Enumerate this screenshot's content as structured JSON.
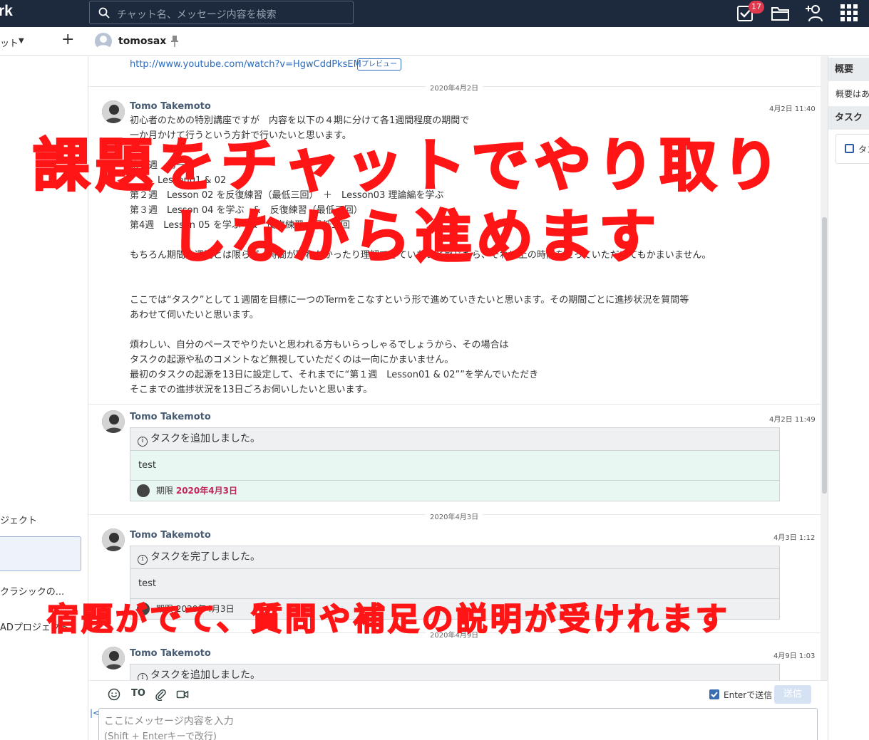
{
  "topbar": {
    "brand": "rk",
    "search_placeholder": "チャット名、メッセージ内容を検索",
    "task_badge": "17",
    "icons": [
      "search-icon",
      "task-check-icon",
      "folder-icon",
      "add-contact-icon",
      "apps-grid-icon"
    ]
  },
  "subbar": {
    "scope_label": "ット",
    "scope_caret": "▼",
    "add_label": "+",
    "room_name": "tomosax"
  },
  "sidebar": {
    "items": [
      {
        "label": "ジェクト"
      },
      {
        "label": ""
      },
      {
        "label": "クラシックの..."
      },
      {
        "label": "ADプロジェクト"
      }
    ]
  },
  "timeline": {
    "top_link": "http://www.youtube.com/watch?v=HgwCddPksEM",
    "preview_label": "プレビュー",
    "date_sep_1": "2020年4月2日",
    "date_sep_2": "2020年4月3日",
    "date_sep_3": "2020年4月9日",
    "messages": [
      {
        "sender": "Tomo Takemoto",
        "time": "4月2日 11:40",
        "lines": [
          "初心者のための特別講座ですが　内容を以下の４期に分けて各1週間程度の期間で",
          "一か月かけて行うという方針で行いたいと思います。",
          "",
          "第１週　第一回",
          "　　　Lesson01 & 02",
          "第２週　Lesson 02 を反復練習（最低三回）　＋　Lesson03 理論編を学ぶ",
          "第３週　Lesson 04 を学ぶ　&　反復練習（最低三回）",
          "第4週　Lesson 05 を学ぶ　&　反復練習（最低三回",
          "",
          "もちろん期間は週間とは限らず、時間が取れなかったり理解できていないと感じたら、それ以上の時間をとっていただいてもかまいません。",
          "",
          "",
          "ここでは“タスク”として１週間を目標に一つのTermをこなすという形で進めていきたいと思います。その期間ごとに進捗状況を質問等",
          "あわせて伺いたいと思います。",
          "",
          "煩わしい、自分のペースでやりたいと思われる方もいらっしゃるでしょうから、その場合は",
          "タスクの起源や私のコメントなど無視していただくのは一向にかまいません。",
          "最初のタスクの起源を13日に設定して、それまでに“第１週　Lesson01 & 02””を学んでいただき",
          "そこまでの進捗状況を13日ごろお伺いしたいと思います。"
        ]
      },
      {
        "sender": "Tomo Takemoto",
        "time": "4月2日 11:49",
        "task_header": "タスクを追加しました。",
        "task_body": "test",
        "due_label": "期限",
        "due_date": "2020年4月3日"
      },
      {
        "sender": "Tomo Takemoto",
        "time": "4月3日 1:12",
        "task_header": "タスクを完了しました。",
        "task_body": "test",
        "due_label": "期限",
        "due_date": "2020年4月3日"
      },
      {
        "sender": "Tomo Takemoto",
        "time": "4月9日 1:03",
        "task_header": "タスクを追加しました。"
      }
    ]
  },
  "composer": {
    "to_label": "TO",
    "enter_label": "Enterで送信",
    "send_label": "送信",
    "placeholder_line1": "ここにメッセージ内容を入力",
    "placeholder_line2": "(Shift + Enterキーで改行)",
    "collapse_label": "|<"
  },
  "right_panel": {
    "overview_title": "概要",
    "overview_text": "概要はあ",
    "task_title": "タスク",
    "task_item": "タス"
  },
  "overlay": {
    "line1": "課題をチャットでやり取り",
    "line2": "しながら進めます",
    "line3": "宿題がでて、質問や補足の説明が受けれます"
  },
  "colors": {
    "topbar_bg": "#1d2a3e",
    "accent_blue": "#2a6bbf",
    "due_red": "#c0285a",
    "overlay_red": "#ff1515",
    "task_body_green": "#e8f7f2"
  }
}
